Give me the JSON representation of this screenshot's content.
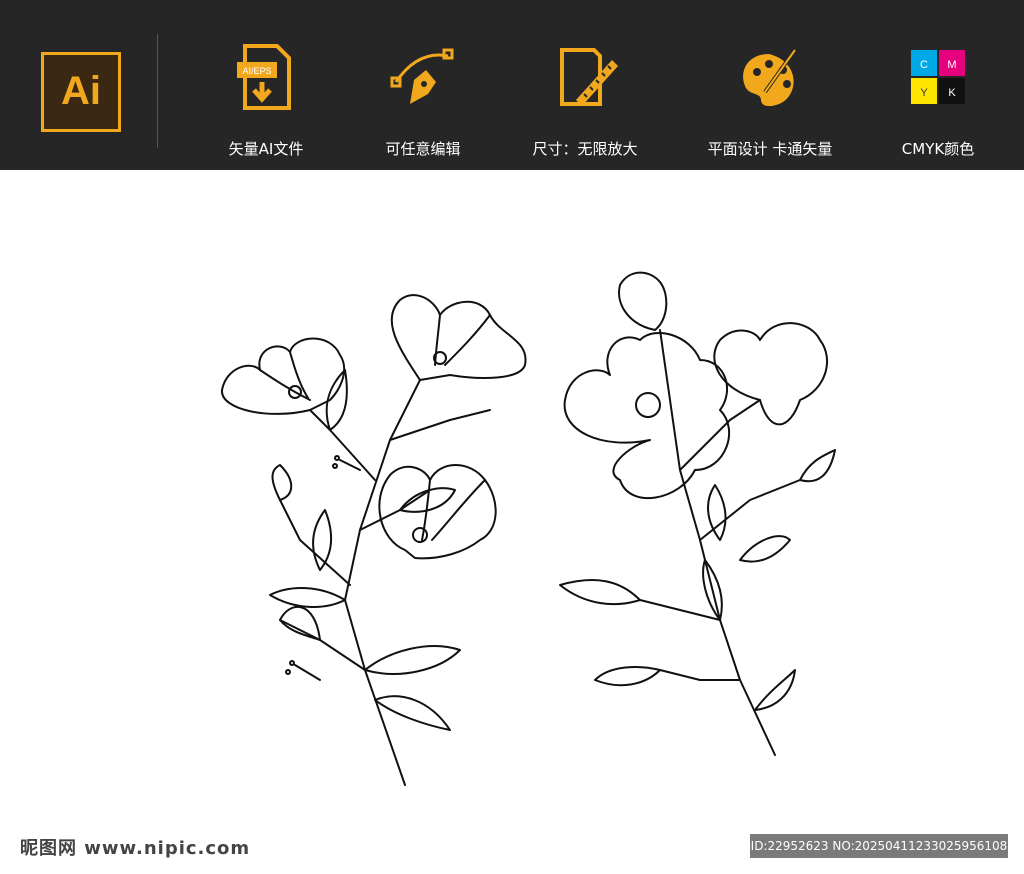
{
  "header": {
    "logo_text": "Ai",
    "features": [
      {
        "icon": "ai-eps-file-icon",
        "label": "矢量AI文件",
        "badge": "AI/EPS"
      },
      {
        "icon": "pen-tool-icon",
        "label": "可任意编辑"
      },
      {
        "icon": "ruler-document-icon",
        "label": "尺寸：无限放大"
      },
      {
        "icon": "palette-icon",
        "label": "平面设计  卡通矢量"
      },
      {
        "icon": "cmyk-puzzle-icon",
        "label": "CMYK颜色",
        "letters": [
          "C",
          "M",
          "Y",
          "K"
        ]
      }
    ]
  },
  "watermark": {
    "left": "昵图网 www.nipic.com",
    "right": "ID:22952623 NO:20250411233025956108"
  },
  "colors": {
    "accent": "#f2a81d",
    "header_bg": "#262626"
  }
}
